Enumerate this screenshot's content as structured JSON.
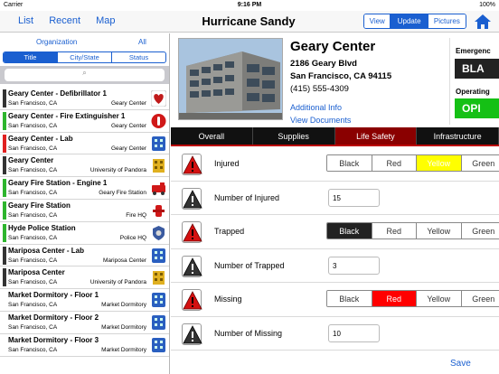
{
  "status": {
    "carrier": "Carrier",
    "time": "9:16 PM",
    "battery": "100%"
  },
  "nav": {
    "links": [
      "List",
      "Recent",
      "Map"
    ],
    "title": "Hurricane Sandy",
    "segments": [
      {
        "label": "View",
        "selected": false
      },
      {
        "label": "Update",
        "selected": true
      },
      {
        "label": "Pictures",
        "selected": false
      }
    ],
    "home_icon": "home-icon"
  },
  "left": {
    "org_label": "Organization",
    "all_label": "All",
    "sort_tabs": [
      {
        "label": "Title",
        "selected": true
      },
      {
        "label": "City/State",
        "selected": false
      },
      {
        "label": "Status",
        "selected": false
      }
    ],
    "search_icon": "⌕",
    "items": [
      {
        "name": "Geary Center - Defibrillator 1",
        "city": "San Francisco, CA",
        "org": "Geary Center",
        "bar": "#333333",
        "icon": "heart"
      },
      {
        "name": "Geary Center - Fire Extinguisher 1",
        "city": "San Francisco, CA",
        "org": "Geary Center",
        "bar": "#2db52d",
        "icon": "extinguisher"
      },
      {
        "name": "Geary Center - Lab",
        "city": "San Francisco, CA",
        "org": "Geary Center",
        "bar": "#e02020",
        "icon": "building-blue"
      },
      {
        "name": "Geary Center",
        "city": "San Francisco, CA",
        "org": "University of Pandora",
        "bar": "#333333",
        "icon": "building-yellow"
      },
      {
        "name": "Geary Fire Station - Engine 1",
        "city": "San Francisco, CA",
        "org": "Geary Fire Station",
        "bar": "#2db52d",
        "icon": "firetruck"
      },
      {
        "name": "Geary Fire Station",
        "city": "San Francisco, CA",
        "org": "Fire HQ",
        "bar": "#2db52d",
        "icon": "hydrant"
      },
      {
        "name": "Hyde Police Station",
        "city": "San Francisco, CA",
        "org": "Police HQ",
        "bar": "#2db52d",
        "icon": "badge"
      },
      {
        "name": "Mariposa Center - Lab",
        "city": "San Francisco, CA",
        "org": "Mariposa Center",
        "bar": "#333333",
        "icon": "building-blue"
      },
      {
        "name": "Mariposa Center",
        "city": "San Francisco, CA",
        "org": "University of Pandora",
        "bar": "#333333",
        "icon": "building-yellow"
      },
      {
        "name": "Market Dormitory - Floor 1",
        "city": "San Francisco, CA",
        "org": "Market Dormitory",
        "bar": "",
        "icon": "building-blue"
      },
      {
        "name": "Market Dormitory - Floor 2",
        "city": "San Francisco, CA",
        "org": "Market Dormitory",
        "bar": "",
        "icon": "building-blue"
      },
      {
        "name": "Market Dormitory - Floor 3",
        "city": "San Francisco, CA",
        "org": "Market Dormitory",
        "bar": "",
        "icon": "building-blue"
      }
    ]
  },
  "detail": {
    "title": "Geary Center",
    "street": "2186 Geary Blvd",
    "citystate": "San Francisco, CA 94115",
    "phone": "(415) 555-4309",
    "more_info": "Additional Info",
    "view_docs": "View Documents",
    "emergency_label": "Emergenc",
    "emergency_value": "BLA",
    "emergency_color": "#222222",
    "operating_label": "Operating",
    "operating_value": "OPI",
    "operating_color": "#15c015",
    "tabs": [
      {
        "label": "Overall",
        "selected": false
      },
      {
        "label": "Supplies",
        "selected": false
      },
      {
        "label": "Life Safety",
        "selected": true
      },
      {
        "label": "Infrastructure",
        "selected": false
      }
    ],
    "rows": [
      {
        "label": "Injured",
        "type": "choice",
        "warn": "red",
        "options": [
          "Black",
          "Red",
          "Yellow",
          "Green"
        ],
        "selected": "Yellow"
      },
      {
        "label": "Number of Injured",
        "type": "number",
        "warn": "black",
        "value": "15"
      },
      {
        "label": "Trapped",
        "type": "choice",
        "warn": "red",
        "options": [
          "Black",
          "Red",
          "Yellow",
          "Green"
        ],
        "selected": "Black"
      },
      {
        "label": "Number of Trapped",
        "type": "number",
        "warn": "black",
        "value": "3"
      },
      {
        "label": "Missing",
        "type": "choice",
        "warn": "red",
        "options": [
          "Black",
          "Red",
          "Yellow",
          "Green"
        ],
        "selected": "Red"
      },
      {
        "label": "Number of Missing",
        "type": "number",
        "warn": "black",
        "value": "10"
      }
    ],
    "save": "Save"
  }
}
